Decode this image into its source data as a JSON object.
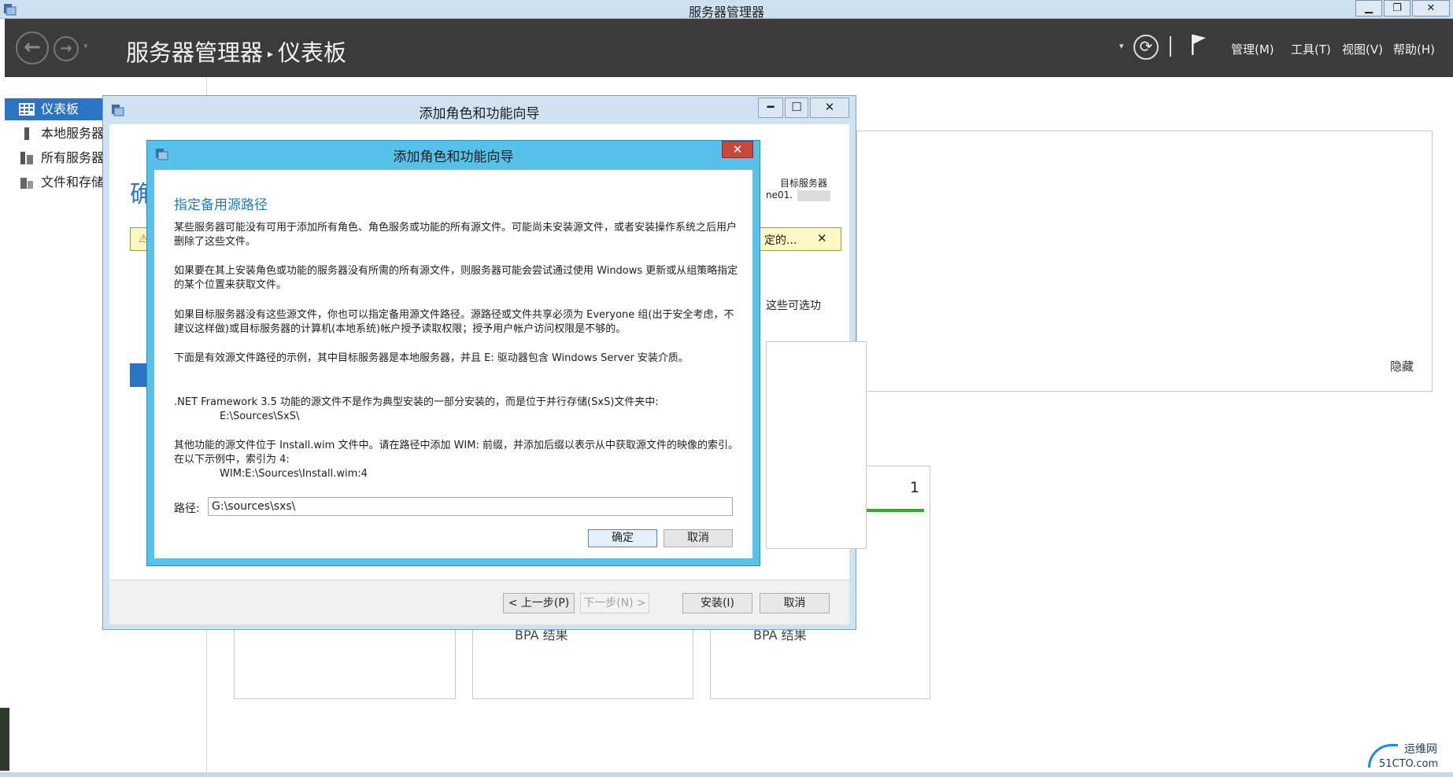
{
  "window": {
    "title": "服务器管理器",
    "min": "▁",
    "restore": "❐",
    "close": "✕"
  },
  "header": {
    "back": "←",
    "forward": "→",
    "nav_dropdown": "▾",
    "breadcrumb_app": "服务器管理器",
    "breadcrumb_sep": "▸",
    "breadcrumb_page": "仪表板",
    "dropdown": "▾",
    "refresh": "⟳",
    "menus": [
      "管理(M)",
      "工具(T)",
      "视图(V)",
      "帮助(H)"
    ]
  },
  "sidebar": {
    "items": [
      {
        "label": "仪表板",
        "icon": "dashboard-icon"
      },
      {
        "label": "本地服务器",
        "icon": "server-icon"
      },
      {
        "label": "所有服务器",
        "icon": "servers-icon"
      },
      {
        "label": "文件和存储服务",
        "icon": "storage-icon"
      }
    ]
  },
  "dashboard": {
    "hide": "隐藏",
    "tile_count": "1",
    "bpa_label": "BPA 结果"
  },
  "wizard": {
    "title": "添加角色和功能向导",
    "min": "━",
    "max": "☐",
    "close": "✕",
    "heading_peek": "确",
    "warning_text": "定的...",
    "warning_close": "✕",
    "warning_icon": "⚠",
    "target_label": "目标服务器",
    "target_value": "ne01.",
    "optional_text": "这些可选功",
    "buttons": {
      "prev": "< 上一步(P)",
      "next": "下一步(N) >",
      "install": "安装(I)",
      "cancel": "取消"
    }
  },
  "dialog": {
    "title": "添加角色和功能向导",
    "close": "✕",
    "heading": "指定备用源路径",
    "paragraphs": [
      "某些服务器可能没有可用于添加所有角色、角色服务或功能的所有源文件。可能尚未安装源文件，或者安装操作系统之后用户删除了这些文件。",
      "如果要在其上安装角色或功能的服务器没有所需的所有源文件，则服务器可能会尝试通过使用 Windows 更新或从组策略指定的某个位置来获取文件。",
      "如果目标服务器没有这些源文件，你也可以指定备用源文件路径。源路径或文件共享必须为 Everyone 组(出于安全考虑，不建议这样做)或目标服务器的计算机(本地系统)帐户授予读取权限；授予用户帐户访问权限是不够的。",
      "下面是有效源文件路径的示例，其中目标服务器是本地服务器，并且 E: 驱动器包含 Windows Server 安装介质。",
      ".NET Framework 3.5 功能的源文件不是作为典型安装的一部分安装的，而是位于并行存储(SxS)文件夹中:",
      "其他功能的源文件位于 Install.wim 文件中。请在路径中添加 WIM: 前缀，并添加后缀以表示从中获取源文件的映像的索引。在以下示例中，索引为 4:"
    ],
    "example_sxs": "E:\\Sources\\SxS\\",
    "example_wim": "WIM:E:\\Sources\\Install.wim:4",
    "path_label": "路径:",
    "path_value": "G:\\sources\\sxs\\",
    "ok": "确定",
    "cancel": "取消"
  },
  "watermark": {
    "line1": "运维网",
    "line2": "51CTO.com"
  },
  "colors": {
    "header_bg": "#3b3b3b",
    "accent": "#2b74c4",
    "dialog_frame": "#58c1ea",
    "close_red": "#c9473d",
    "warning_bg": "#fbf8c4"
  }
}
